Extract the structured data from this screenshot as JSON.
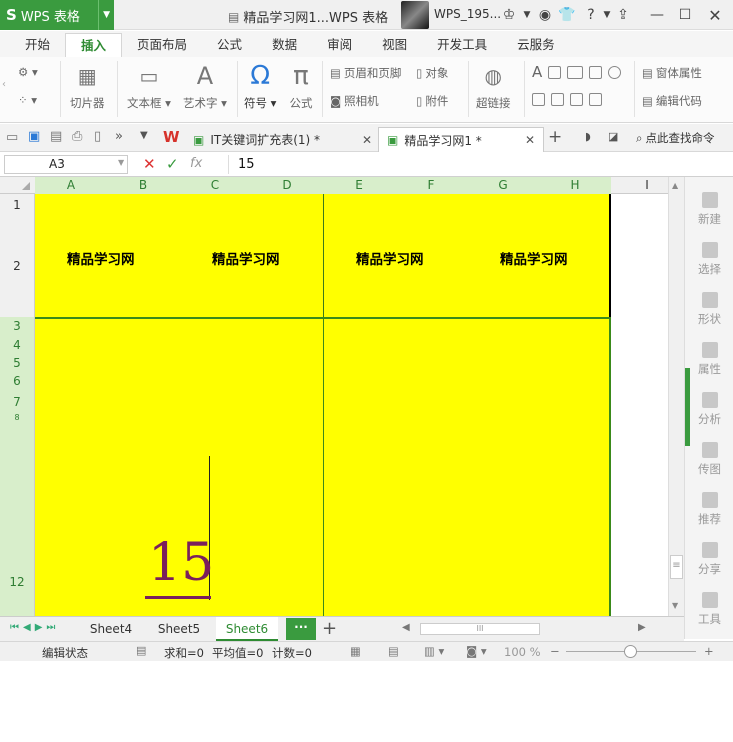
{
  "app": {
    "logo": "S",
    "name": "WPS 表格"
  },
  "title": {
    "document": "精品学习网1...WPS 表格",
    "user": "WPS_195..."
  },
  "ribbon_tabs": [
    "开始",
    "插入",
    "页面布局",
    "公式",
    "数据",
    "审阅",
    "视图",
    "开发工具",
    "云服务"
  ],
  "ribbon": {
    "slicer": "切片器",
    "textbox": "文本框",
    "wordart": "艺术字",
    "symbol": "符号",
    "formula": "公式",
    "header_footer": "页眉和页脚",
    "object": "对象",
    "camera": "照相机",
    "attachment": "附件",
    "hyperlink": "超链接",
    "form_properties": "窗体属性",
    "edit_code": "编辑代码",
    "symbol_glyph": "Ω",
    "formula_glyph": "π"
  },
  "doc_tabs": [
    {
      "label": "IT关键词扩充表(1) *"
    },
    {
      "label": "精品学习网1 *"
    }
  ],
  "search_label": "点此查找命令",
  "formula_bar": {
    "cell_ref": "A3",
    "fx": "fx",
    "value": "15"
  },
  "columns": [
    "A",
    "B",
    "C",
    "D",
    "E",
    "F",
    "G",
    "H",
    "I"
  ],
  "rows": [
    "1",
    "2",
    "3",
    "4",
    "5",
    "6",
    "7",
    "8",
    "12"
  ],
  "cells": {
    "header_1": "精品学习网",
    "header_2": "精品学习网",
    "header_3": "精品学习网",
    "header_4": "精品学习网",
    "editing_value": "15"
  },
  "side_panel": [
    "新建",
    "选择",
    "形状",
    "属性",
    "分析",
    "传图",
    "推荐",
    "分享",
    "工具"
  ],
  "sheets": [
    "Sheet4",
    "Sheet5",
    "Sheet6"
  ],
  "status": {
    "mode": "编辑状态",
    "sum": "求和=0",
    "avg": "平均值=0",
    "count": "计数=0",
    "zoom": "100 %"
  },
  "colors": {
    "accent": "#3a9b3f",
    "cell_fill": "#ffff00",
    "edit_text": "#7a1f5c"
  }
}
